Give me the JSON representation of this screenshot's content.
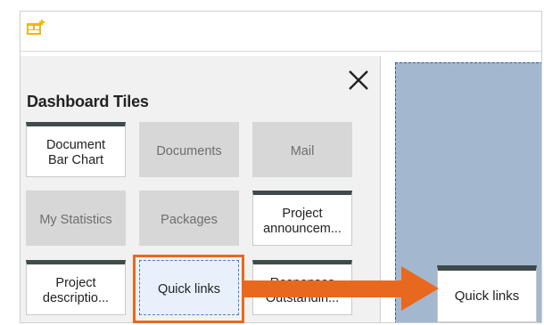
{
  "panel": {
    "title": "Dashboard Tiles",
    "close_icon": "close-icon"
  },
  "toolbar": {
    "add_tile_icon": "add-tile-icon"
  },
  "tiles": [
    {
      "line1": "Document",
      "line2": "Bar Chart",
      "state": "active"
    },
    {
      "line1": "Documents",
      "line2": "",
      "state": "inactive"
    },
    {
      "line1": "Mail",
      "line2": "",
      "state": "inactive"
    },
    {
      "line1": "My Statistics",
      "line2": "",
      "state": "inactive"
    },
    {
      "line1": "Packages",
      "line2": "",
      "state": "inactive"
    },
    {
      "line1": "Project",
      "line2": "announcem...",
      "state": "active"
    },
    {
      "line1": "Project",
      "line2": "descriptio...",
      "state": "active"
    },
    {
      "line1": "Quick links",
      "line2": "",
      "state": "dragging"
    },
    {
      "line1": "Responses",
      "line2": "Outstandin...",
      "state": "active"
    }
  ],
  "dropped_tile": {
    "label": "Quick links"
  },
  "colors": {
    "highlight": "#e8691e",
    "canvas": "#a3b8cf",
    "tile_header": "#3f4a4a",
    "icon": "#f2b705"
  }
}
